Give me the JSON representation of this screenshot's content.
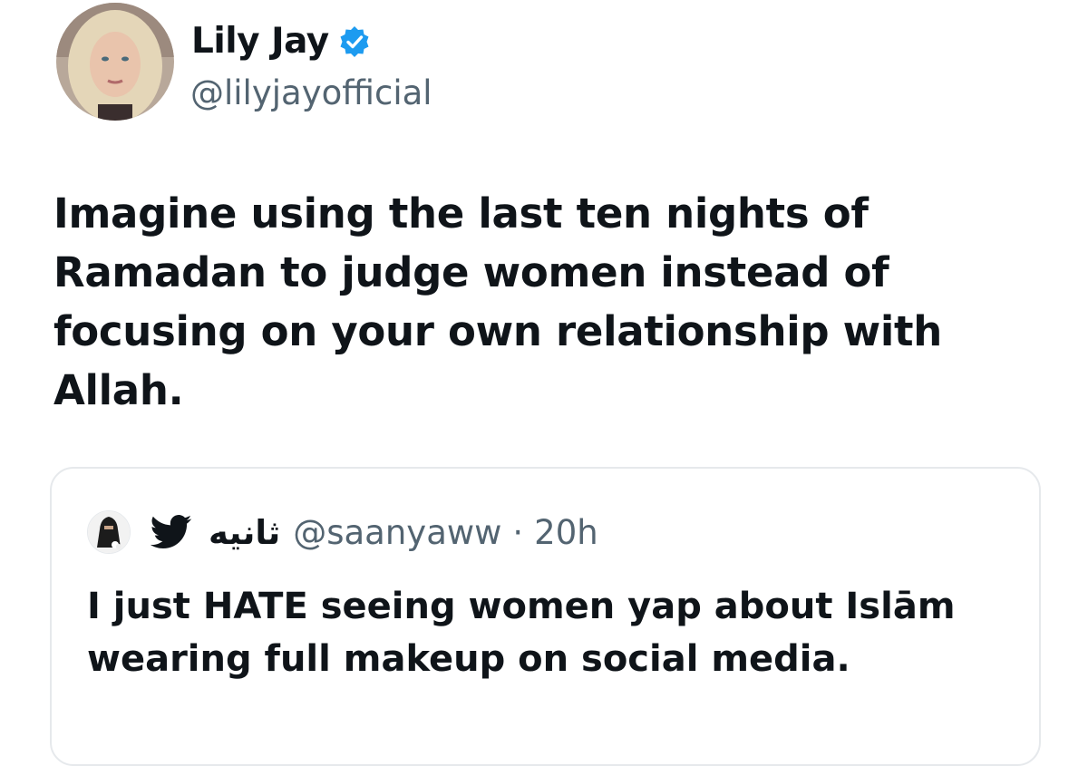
{
  "author": {
    "display_name": "Lily Jay",
    "handle": "@lilyjayofficial",
    "verified_icon": "verified-badge-icon",
    "verified_color": "#1d9bf0"
  },
  "tweet": {
    "text": "Imagine using the last ten nights of Ramadan to judge women instead of focusing on your own relationship with Allah."
  },
  "quoted_tweet": {
    "display_name": "ثانيه",
    "name_icon": "bird-icon",
    "handle": "@saanyaww",
    "separator": "·",
    "time": "20h",
    "text": "I just HATE seeing women yap about Islām wearing full makeup on social media."
  },
  "colors": {
    "text": "#0f1419",
    "secondary": "#536471",
    "border": "#e6e9ec"
  }
}
